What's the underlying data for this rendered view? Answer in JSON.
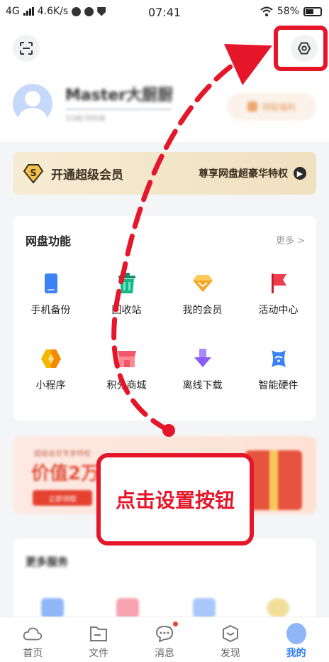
{
  "status_bar": {
    "network": "4G",
    "speed": "4.6K/s",
    "time": "07:41",
    "battery": "58%"
  },
  "profile": {
    "username": "Master大厨厨",
    "uid": "1GB/30GB",
    "pill_label": "领取福利"
  },
  "vip": {
    "title": "开通超级会员",
    "subtitle": "尊享网盘超豪华特权"
  },
  "features": {
    "title": "网盘功能",
    "more": "更多 >",
    "items": [
      {
        "label": "手机备份",
        "icon": "phone-backup-icon",
        "color": "#3b82f6"
      },
      {
        "label": "回收站",
        "icon": "trash-icon",
        "color": "#10b98a"
      },
      {
        "label": "我的会员",
        "icon": "diamond-icon",
        "color": "#f5a524"
      },
      {
        "label": "活动中心",
        "icon": "flag-icon",
        "color": "#ef3b4a"
      },
      {
        "label": "小程序",
        "icon": "hexagon-icon",
        "color": "#f7b500"
      },
      {
        "label": "积分商城",
        "icon": "store-icon",
        "color": "#f2566a"
      },
      {
        "label": "离线下载",
        "icon": "download-icon",
        "color": "#8b5cf6"
      },
      {
        "label": "智能硬件",
        "icon": "smart-hardware-icon",
        "color": "#3b82f6"
      }
    ]
  },
  "banner": {
    "small": "超级会员专享特权",
    "title": "价值2万元资源免费享",
    "button": "立即领取"
  },
  "more_services": {
    "title": "更多服务"
  },
  "tabs": [
    {
      "label": "首页",
      "icon": "home-cloud-icon"
    },
    {
      "label": "文件",
      "icon": "folder-icon"
    },
    {
      "label": "消息",
      "icon": "message-icon"
    },
    {
      "label": "发现",
      "icon": "discover-icon"
    },
    {
      "label": "我的",
      "icon": "me-avatar-icon"
    }
  ],
  "annotation": {
    "callout": "点击设置按钮"
  },
  "colors": {
    "accent": "#2e7cf6",
    "annotation_red": "#e5162a"
  }
}
